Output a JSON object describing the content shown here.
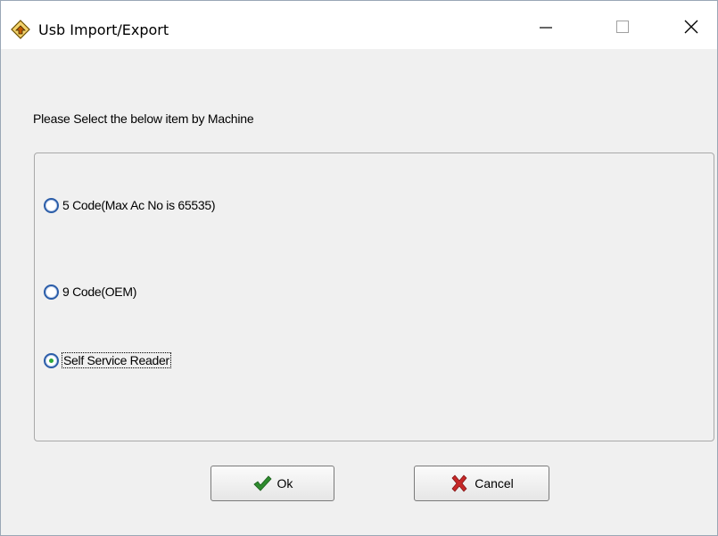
{
  "window": {
    "title": "Usb Import/Export",
    "icon": "usb-import-export-app-icon",
    "controls": [
      "minimize-icon",
      "maximize-icon",
      "close-icon"
    ]
  },
  "dialog": {
    "instruction": "Please Select the below item by Machine",
    "options": [
      {
        "label": "5 Code(Max Ac No is 65535)",
        "checked": false
      },
      {
        "label": "9 Code(OEM)",
        "checked": false
      },
      {
        "label": "Self Service Reader",
        "checked": true
      }
    ],
    "buttons": {
      "ok_label": "Ok",
      "ok_icon": "checkmark-icon",
      "cancel_label": "Cancel",
      "cancel_icon": "x-mark-icon"
    }
  },
  "colors": {
    "radio_border": "#2b5da8",
    "radio_dot": "#2ba83b",
    "ok_icon": "#2e8b2e",
    "cancel_icon": "#c62828"
  }
}
